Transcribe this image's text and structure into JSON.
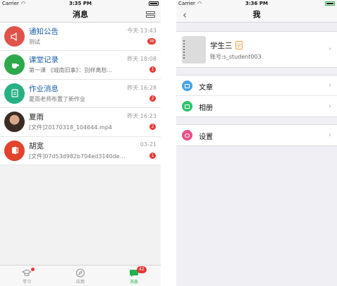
{
  "left": {
    "statusbar": {
      "carrier": "Carrier",
      "time": "3:35 PM"
    },
    "navbar": {
      "title": "消息"
    },
    "messages": [
      {
        "name": "通知公告",
        "preview": "测试",
        "time": "今天 13:43",
        "badge": "36",
        "icon": "speaker-icon",
        "color": "#e0534a",
        "highlight": true
      },
      {
        "name": "课堂记录",
        "preview": "第一课 《城南旧事》：别样离愁...",
        "time": "昨天 18:08",
        "badge": "1",
        "icon": "coffee-cup-icon",
        "color": "#2ea94a",
        "highlight": true
      },
      {
        "name": "作业消息",
        "preview": "夏雨老师布置了新作业",
        "time": "昨天 16:28",
        "badge": "2",
        "icon": "clipboard-icon",
        "color": "#27b084",
        "highlight": true
      },
      {
        "name": "夏雨",
        "preview": "[文件]20170318_104644.mp4",
        "time": "昨天 16:23",
        "badge": "2",
        "icon": "user-photo",
        "color": "#4a3b33",
        "highlight": false
      },
      {
        "name": "胡宽",
        "preview": "[文件]07d53d982b704ed3140de...",
        "time": "03-21",
        "badge": "1",
        "icon": "office-icon",
        "color": "#e0442d",
        "highlight": false
      }
    ],
    "tabbar": {
      "tabs": [
        {
          "label": "学习",
          "icon": "graduation-cap-icon"
        },
        {
          "label": "应用",
          "icon": "compass-icon"
        },
        {
          "label": "消息",
          "icon": "chat-bubble-icon",
          "badge": "42"
        }
      ]
    }
  },
  "right": {
    "statusbar": {
      "carrier": "Carrier",
      "time": "3:36 PM"
    },
    "navbar": {
      "title": "我",
      "back": "‹"
    },
    "profile": {
      "name": "学生三",
      "tag": "学",
      "account": "账号:s_student003"
    },
    "menu_group_1": [
      {
        "label": "文章",
        "icon": "article-icon",
        "color": "#4aa3e8"
      },
      {
        "label": "相册",
        "icon": "album-icon",
        "color": "#2ec36a"
      }
    ],
    "menu_group_2": [
      {
        "label": "设置",
        "icon": "settings-icon",
        "color": "#e8508a"
      }
    ]
  }
}
